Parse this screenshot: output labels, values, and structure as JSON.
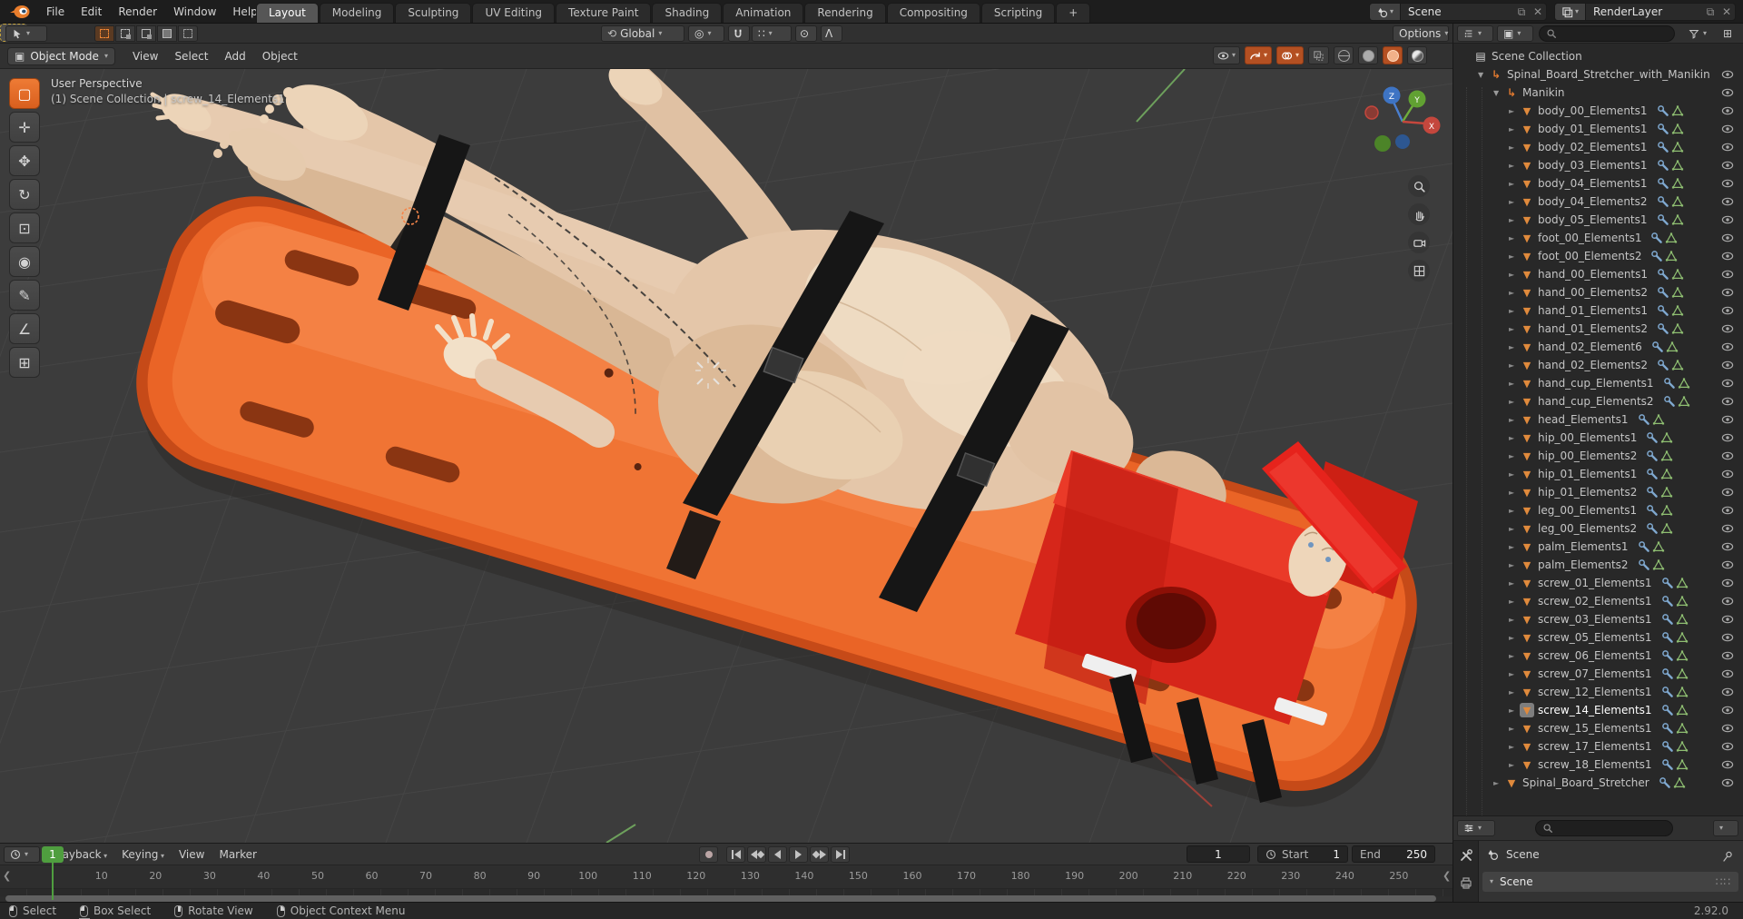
{
  "topbar": {
    "menus": [
      "File",
      "Edit",
      "Render",
      "Window",
      "Help"
    ],
    "tabs": [
      {
        "label": "Layout",
        "active": true
      },
      {
        "label": "Modeling"
      },
      {
        "label": "Sculpting"
      },
      {
        "label": "UV Editing"
      },
      {
        "label": "Texture Paint"
      },
      {
        "label": "Shading"
      },
      {
        "label": "Animation"
      },
      {
        "label": "Rendering"
      },
      {
        "label": "Compositing"
      },
      {
        "label": "Scripting"
      },
      {
        "label": "+"
      }
    ],
    "scene_selector": {
      "value": "Scene"
    },
    "view_layer_selector": {
      "value": "RenderLayer"
    }
  },
  "tool_settings": {
    "orientation_value": "Global",
    "options_label": "Options"
  },
  "viewport": {
    "mode_value": "Object Mode",
    "menus": [
      "View",
      "Select",
      "Add",
      "Object"
    ],
    "overlay": {
      "line1": "User Perspective",
      "line2": "(1) Scene Collection | screw_14_Elements1"
    },
    "gizmo_axes": {
      "z": "Z",
      "y": "Y",
      "x": "X"
    },
    "tools": [
      {
        "name": "box-select",
        "glyph": "▢",
        "active": true
      },
      {
        "name": "cursor",
        "glyph": "✛"
      },
      {
        "name": "move",
        "glyph": "✥"
      },
      {
        "name": "rotate",
        "glyph": "↻"
      },
      {
        "name": "scale",
        "glyph": "⊡"
      },
      {
        "name": "transform",
        "glyph": "◉"
      },
      {
        "name": "annotate",
        "glyph": "✎"
      },
      {
        "name": "measure",
        "glyph": "∠"
      },
      {
        "name": "add-cube",
        "glyph": "⊞"
      }
    ]
  },
  "outliner": {
    "rows": [
      {
        "name": "Scene Collection",
        "icon": "collection",
        "indent": 0
      },
      {
        "name": "Spinal_Board_Stretcher_with_Manikin",
        "icon": "empty",
        "indent": 1,
        "arrow": "down"
      },
      {
        "name": "Manikin",
        "icon": "empty",
        "indent": 2,
        "arrow": "down"
      },
      {
        "name": "body_00_Elements1",
        "icon": "mesh",
        "indent": 3,
        "arrow": "right"
      },
      {
        "name": "body_01_Elements1",
        "icon": "mesh",
        "indent": 3,
        "arrow": "right"
      },
      {
        "name": "body_02_Elements1",
        "icon": "mesh",
        "indent": 3,
        "arrow": "right"
      },
      {
        "name": "body_03_Elements1",
        "icon": "mesh",
        "indent": 3,
        "arrow": "right"
      },
      {
        "name": "body_04_Elements1",
        "icon": "mesh",
        "indent": 3,
        "arrow": "right"
      },
      {
        "name": "body_04_Elements2",
        "icon": "mesh",
        "indent": 3,
        "arrow": "right"
      },
      {
        "name": "body_05_Elements1",
        "icon": "mesh",
        "indent": 3,
        "arrow": "right"
      },
      {
        "name": "foot_00_Elements1",
        "icon": "mesh",
        "indent": 3,
        "arrow": "right"
      },
      {
        "name": "foot_00_Elements2",
        "icon": "mesh",
        "indent": 3,
        "arrow": "right"
      },
      {
        "name": "hand_00_Elements1",
        "icon": "mesh",
        "indent": 3,
        "arrow": "right"
      },
      {
        "name": "hand_00_Elements2",
        "icon": "mesh",
        "indent": 3,
        "arrow": "right"
      },
      {
        "name": "hand_01_Elements1",
        "icon": "mesh",
        "indent": 3,
        "arrow": "right"
      },
      {
        "name": "hand_01_Elements2",
        "icon": "mesh",
        "indent": 3,
        "arrow": "right"
      },
      {
        "name": "hand_02_Element6",
        "icon": "mesh",
        "indent": 3,
        "arrow": "right"
      },
      {
        "name": "hand_02_Elements2",
        "icon": "mesh",
        "indent": 3,
        "arrow": "right"
      },
      {
        "name": "hand_cup_Elements1",
        "icon": "mesh",
        "indent": 3,
        "arrow": "right"
      },
      {
        "name": "hand_cup_Elements2",
        "icon": "mesh",
        "indent": 3,
        "arrow": "right"
      },
      {
        "name": "head_Elements1",
        "icon": "mesh",
        "indent": 3,
        "arrow": "right"
      },
      {
        "name": "hip_00_Elements1",
        "icon": "mesh",
        "indent": 3,
        "arrow": "right"
      },
      {
        "name": "hip_00_Elements2",
        "icon": "mesh",
        "indent": 3,
        "arrow": "right"
      },
      {
        "name": "hip_01_Elements1",
        "icon": "mesh",
        "indent": 3,
        "arrow": "right"
      },
      {
        "name": "hip_01_Elements2",
        "icon": "mesh",
        "indent": 3,
        "arrow": "right"
      },
      {
        "name": "leg_00_Elements1",
        "icon": "mesh",
        "indent": 3,
        "arrow": "right"
      },
      {
        "name": "leg_00_Elements2",
        "icon": "mesh",
        "indent": 3,
        "arrow": "right"
      },
      {
        "name": "palm_Elements1",
        "icon": "mesh",
        "indent": 3,
        "arrow": "right"
      },
      {
        "name": "palm_Elements2",
        "icon": "mesh",
        "indent": 3,
        "arrow": "right"
      },
      {
        "name": "screw_01_Elements1",
        "icon": "mesh",
        "indent": 3,
        "arrow": "right"
      },
      {
        "name": "screw_02_Elements1",
        "icon": "mesh",
        "indent": 3,
        "arrow": "right"
      },
      {
        "name": "screw_03_Elements1",
        "icon": "mesh",
        "indent": 3,
        "arrow": "right"
      },
      {
        "name": "screw_05_Elements1",
        "icon": "mesh",
        "indent": 3,
        "arrow": "right"
      },
      {
        "name": "screw_06_Elements1",
        "icon": "mesh",
        "indent": 3,
        "arrow": "right"
      },
      {
        "name": "screw_07_Elements1",
        "icon": "mesh",
        "indent": 3,
        "arrow": "right"
      },
      {
        "name": "screw_12_Elements1",
        "icon": "mesh",
        "indent": 3,
        "arrow": "right"
      },
      {
        "name": "screw_14_Elements1",
        "icon": "mesh",
        "indent": 3,
        "arrow": "right",
        "active": true
      },
      {
        "name": "screw_15_Elements1",
        "icon": "mesh",
        "indent": 3,
        "arrow": "right"
      },
      {
        "name": "screw_17_Elements1",
        "icon": "mesh",
        "indent": 3,
        "arrow": "right"
      },
      {
        "name": "screw_18_Elements1",
        "icon": "mesh",
        "indent": 3,
        "arrow": "right"
      },
      {
        "name": "Spinal_Board_Stretcher",
        "icon": "mesh",
        "indent": 2,
        "arrow": "right"
      }
    ]
  },
  "properties": {
    "breadcrumb": "Scene",
    "section_label": "Scene"
  },
  "timeline": {
    "menus": [
      {
        "label": "Playback",
        "dd": true
      },
      {
        "label": "Keying",
        "dd": true
      },
      {
        "label": "View"
      },
      {
        "label": "Marker"
      }
    ],
    "current_frame": "1",
    "ticks": [
      "10",
      "20",
      "30",
      "40",
      "50",
      "60",
      "70",
      "80",
      "90",
      "100",
      "110",
      "120",
      "130",
      "140",
      "150",
      "160",
      "170",
      "180",
      "190",
      "200",
      "210",
      "220",
      "230",
      "240",
      "250"
    ],
    "start_label": "Start",
    "start_value": "1",
    "end_label": "End",
    "end_value": "250"
  },
  "status_bar": {
    "hints": [
      {
        "icon": "mouse-left",
        "label": "Select"
      },
      {
        "icon": "mouse-drag",
        "label": "Box Select"
      },
      {
        "icon": "mouse-middle",
        "label": "Rotate View"
      },
      {
        "icon": "mouse-right",
        "label": "Object Context Menu"
      }
    ],
    "version": "2.92.0"
  },
  "colors": {
    "accent_orange": "#e8702d",
    "board_orange": "#ea6426",
    "head_block_red": "#d6261a",
    "frame_green": "#4f9e3f",
    "skin": "#e4c6a9"
  }
}
